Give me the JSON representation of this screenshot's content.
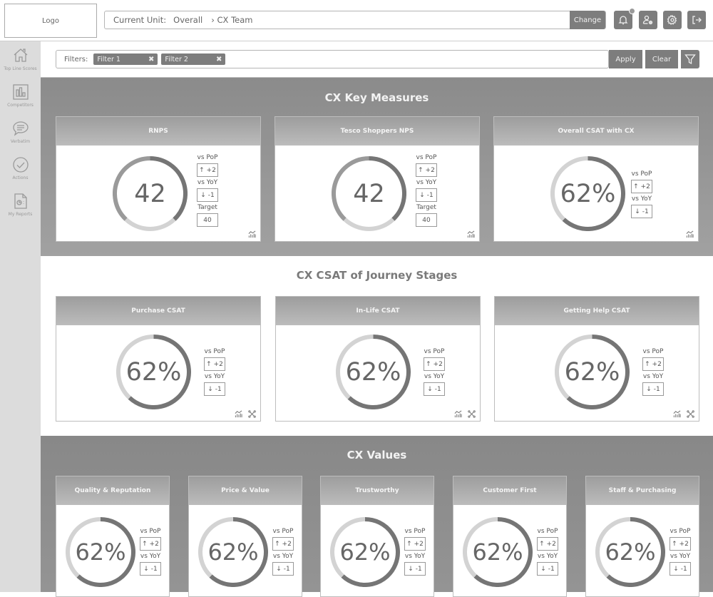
{
  "header": {
    "logo": "Logo",
    "unit_label": "Current Unit:",
    "unit_value": "Overall",
    "unit_crumb": "› CX Team",
    "change_label": "Change",
    "icons": [
      "bell-icon",
      "user-settings-icon",
      "gear-icon",
      "logout-icon"
    ],
    "notification_badge": true
  },
  "sidebar": {
    "items": [
      {
        "label": "Top Line Scores",
        "icon": "home-icon",
        "active": true
      },
      {
        "label": "Competitors",
        "icon": "bar-chart-icon"
      },
      {
        "label": "Verbatim",
        "icon": "speech-bubble-icon"
      },
      {
        "label": "Actions",
        "icon": "check-circle-icon"
      },
      {
        "label": "My Reports",
        "icon": "report-icon"
      }
    ]
  },
  "filters": {
    "label": "Filters:",
    "chips": [
      {
        "label": "Filter 1"
      },
      {
        "label": "Filter 2"
      }
    ],
    "remove_glyph": "✖",
    "apply_label": "Apply",
    "clear_label": "Clear"
  },
  "colors": {
    "gauge_dark": "#757575",
    "gauge_mid": "#9a9a9a",
    "gauge_light": "#d3d3d3"
  },
  "sections": {
    "key_measures": {
      "title": "CX Key Measures",
      "cards": [
        {
          "title": "RNPS",
          "value": "42",
          "type": "nps",
          "pop_label": "vs PoP",
          "pop": "↑ +2",
          "yoy_label": "vs YoY",
          "yoy": "↓ -1",
          "target_label": "Target",
          "target": "40"
        },
        {
          "title": "Tesco Shoppers NPS",
          "value": "42",
          "type": "nps",
          "pop_label": "vs PoP",
          "pop": "↑ +2",
          "yoy_label": "vs YoY",
          "yoy": "↓ -1",
          "target_label": "Target",
          "target": "40"
        },
        {
          "title": "Overall CSAT with CX",
          "value": "62%",
          "percent": 62,
          "type": "pct",
          "pop_label": "vs PoP",
          "pop": "↑ +2",
          "yoy_label": "vs YoY",
          "yoy": "↓ -1"
        }
      ]
    },
    "journey": {
      "title": "CX CSAT of Journey Stages",
      "cards": [
        {
          "title": "Purchase CSAT",
          "value": "62%",
          "percent": 62,
          "pop_label": "vs PoP",
          "pop": "↑ +2",
          "yoy_label": "vs YoY",
          "yoy": "↓ -1"
        },
        {
          "title": "In-Life CSAT",
          "value": "62%",
          "percent": 62,
          "pop_label": "vs PoP",
          "pop": "↑ +2",
          "yoy_label": "vs YoY",
          "yoy": "↓ -1"
        },
        {
          "title": "Getting Help CSAT",
          "value": "62%",
          "percent": 62,
          "pop_label": "vs PoP",
          "pop": "↑ +2",
          "yoy_label": "vs YoY",
          "yoy": "↓ -1"
        }
      ]
    },
    "values": {
      "title": "CX Values",
      "cards": [
        {
          "title": "Quality & Reputation",
          "value": "62%",
          "percent": 62,
          "pop_label": "vs PoP",
          "pop": "↑ +2",
          "yoy_label": "vs YoY",
          "yoy": "↓ -1"
        },
        {
          "title": "Price & Value",
          "value": "62%",
          "percent": 62,
          "pop_label": "vs PoP",
          "pop": "↑ +2",
          "yoy_label": "vs YoY",
          "yoy": "↓ -1"
        },
        {
          "title": "Trustworthy",
          "value": "62%",
          "percent": 62,
          "pop_label": "vs PoP",
          "pop": "↑ +2",
          "yoy_label": "vs YoY",
          "yoy": "↓ -1"
        },
        {
          "title": "Customer First",
          "value": "62%",
          "percent": 62,
          "pop_label": "vs PoP",
          "pop": "↑ +2",
          "yoy_label": "vs YoY",
          "yoy": "↓ -1"
        },
        {
          "title": "Staff & Purchasing",
          "value": "62%",
          "percent": 62,
          "pop_label": "vs PoP",
          "pop": "↑ +2",
          "yoy_label": "vs YoY",
          "yoy": "↓ -1"
        }
      ]
    }
  }
}
